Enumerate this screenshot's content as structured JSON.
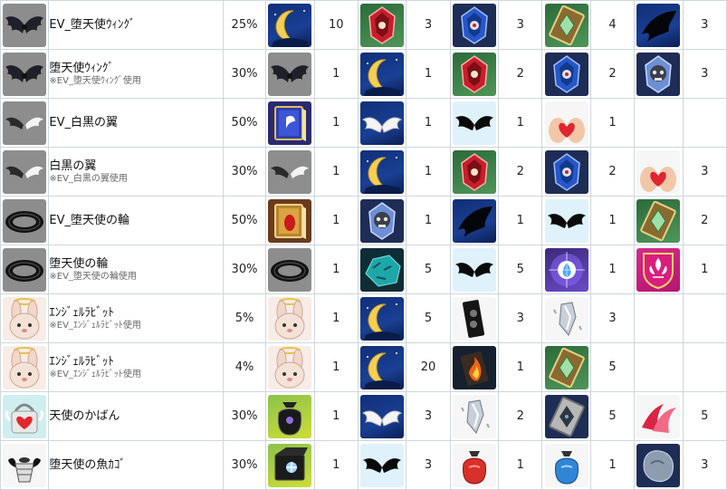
{
  "rows": [
    {
      "icon": "wing-dark-icon",
      "name": "EV_堕天使ｳｨﾝｸﾞ",
      "note": "",
      "rate": "25%",
      "items": [
        {
          "icon": "moon-icon",
          "count": "10"
        },
        {
          "icon": "red-gem-icon",
          "count": "3"
        },
        {
          "icon": "blue-gem-icon",
          "count": "3"
        },
        {
          "icon": "green-card-icon",
          "count": "4"
        },
        {
          "icon": "black-wing-icon",
          "count": "3"
        }
      ]
    },
    {
      "icon": "wing-dark-icon",
      "name": "堕天使ｳｨﾝｸﾞ",
      "note": "※EV_堕天使ｳｨﾝｸﾞ使用",
      "rate": "30%",
      "items": [
        {
          "icon": "wing-dark-icon",
          "count": "1"
        },
        {
          "icon": "moon-icon",
          "count": "1"
        },
        {
          "icon": "red-gem-icon",
          "count": "2"
        },
        {
          "icon": "blue-gem-icon",
          "count": "2"
        },
        {
          "icon": "skull-gem-icon",
          "count": "3"
        }
      ]
    },
    {
      "icon": "wing-bw-icon",
      "name": "EV_白黒の翼",
      "note": "",
      "rate": "50%",
      "items": [
        {
          "icon": "blue-book-icon",
          "count": "1"
        },
        {
          "icon": "white-wings-icon",
          "count": "1"
        },
        {
          "icon": "black-wings-icon",
          "count": "1"
        },
        {
          "icon": "heart-hands-icon",
          "count": "1"
        },
        {
          "icon": "",
          "count": ""
        }
      ]
    },
    {
      "icon": "wing-bw-icon",
      "name": "白黒の翼",
      "note": "※EV_白黒の翼使用",
      "rate": "30%",
      "items": [
        {
          "icon": "wing-bw-icon",
          "count": "1"
        },
        {
          "icon": "moon-icon",
          "count": "1"
        },
        {
          "icon": "red-gem-icon",
          "count": "2"
        },
        {
          "icon": "blue-gem-icon",
          "count": "2"
        },
        {
          "icon": "heart-hands-icon",
          "count": "3"
        }
      ]
    },
    {
      "icon": "halo-ring-icon",
      "name": "EV_堕天使の輪",
      "note": "",
      "rate": "50%",
      "items": [
        {
          "icon": "red-book-icon",
          "count": "1"
        },
        {
          "icon": "skull-gem-icon",
          "count": "1"
        },
        {
          "icon": "black-wing-icon",
          "count": "1"
        },
        {
          "icon": "black-wings-icon",
          "count": "1"
        },
        {
          "icon": "green-card-icon",
          "count": "2"
        }
      ]
    },
    {
      "icon": "halo-ring-icon",
      "name": "堕天使の輪",
      "note": "※EV_堕天使の輪使用",
      "rate": "30%",
      "items": [
        {
          "icon": "halo-ring-icon",
          "count": "1"
        },
        {
          "icon": "teal-ore-icon",
          "count": "5"
        },
        {
          "icon": "black-wings-icon",
          "count": "5"
        },
        {
          "icon": "purple-flare-icon",
          "count": "1"
        },
        {
          "icon": "fleur-emblem-icon",
          "count": "1"
        }
      ]
    },
    {
      "icon": "angel-bunny-icon",
      "name": "ｴﾝｼﾞｪﾙﾗﾋﾞｯﾄ",
      "note": "※EV_ｴﾝｼﾞｪﾙﾗﾋﾞｯﾄ使用",
      "rate": "5%",
      "items": [
        {
          "icon": "angel-bunny-icon",
          "count": "1"
        },
        {
          "icon": "moon-icon",
          "count": "5"
        },
        {
          "icon": "speaker-block-icon",
          "count": "3"
        },
        {
          "icon": "crystal-shard-icon",
          "count": "3"
        },
        {
          "icon": "",
          "count": ""
        }
      ]
    },
    {
      "icon": "angel-bunny-icon",
      "name": "ｴﾝｼﾞｪﾙﾗﾋﾞｯﾄ",
      "note": "※EV_ｴﾝｼﾞｪﾙﾗﾋﾞｯﾄ使用",
      "rate": "4%",
      "items": [
        {
          "icon": "angel-bunny-icon",
          "count": "1"
        },
        {
          "icon": "moon-icon",
          "count": "20"
        },
        {
          "icon": "fire-block-icon",
          "count": "1"
        },
        {
          "icon": "green-card-icon",
          "count": "5"
        },
        {
          "icon": "",
          "count": ""
        }
      ]
    },
    {
      "icon": "angel-bag-icon",
      "name": "天使のかばん",
      "note": "",
      "rate": "30%",
      "items": [
        {
          "icon": "black-pouch-icon",
          "count": "1"
        },
        {
          "icon": "white-wings-icon",
          "count": "3"
        },
        {
          "icon": "crystal-shard-icon",
          "count": "2"
        },
        {
          "icon": "dark-card-icon",
          "count": "5"
        },
        {
          "icon": "pink-ribbon-icon",
          "count": "5"
        }
      ]
    },
    {
      "icon": "fish-basket-icon",
      "name": "堕天使の魚ｶｺﾞ",
      "note": "",
      "rate": "30%",
      "items": [
        {
          "icon": "dark-box-icon",
          "count": "1"
        },
        {
          "icon": "black-wings-icon",
          "count": "3"
        },
        {
          "icon": "red-pouch-icon",
          "count": "1"
        },
        {
          "icon": "blue-pouch-icon",
          "count": "1"
        },
        {
          "icon": "grey-stone-icon",
          "count": "3"
        }
      ]
    }
  ]
}
